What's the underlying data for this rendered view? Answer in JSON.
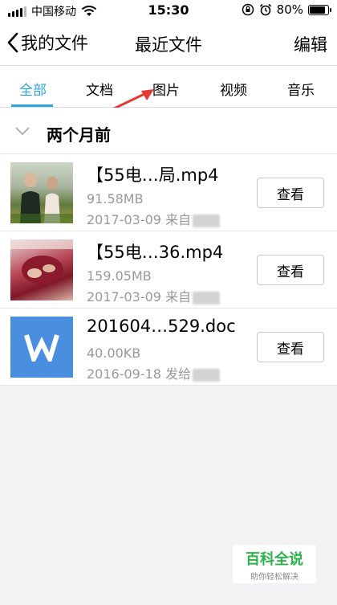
{
  "status_bar": {
    "carrier": "中国移动",
    "time": "15:30",
    "battery": "80%",
    "battery_level": 0.8
  },
  "nav": {
    "back_label": "我的文件",
    "title": "最近文件",
    "edit_label": "编辑"
  },
  "tabs": [
    {
      "label": "全部",
      "active": true
    },
    {
      "label": "文档"
    },
    {
      "label": "图片"
    },
    {
      "label": "视频"
    },
    {
      "label": "音乐"
    }
  ],
  "section": {
    "title": "两个月前"
  },
  "files": [
    {
      "name": "【55电…局.mp4",
      "size": "91.58MB",
      "meta": "2017-03-09 来自",
      "button": "查看",
      "type": "video"
    },
    {
      "name": "【55电…36.mp4",
      "size": "159.05MB",
      "meta": "2017-03-09 来自",
      "button": "查看",
      "type": "video"
    },
    {
      "name": "201604…529.doc",
      "size": "40.00KB",
      "meta": "2016-09-18 发给",
      "button": "查看",
      "type": "doc"
    }
  ],
  "watermark": {
    "main": "百科全说",
    "sub": "助你轻松解决"
  },
  "colors": {
    "accent": "#2ea3e3",
    "annotation_arrow": "#e53935",
    "doc_icon_bg": "#4a8fdf"
  }
}
